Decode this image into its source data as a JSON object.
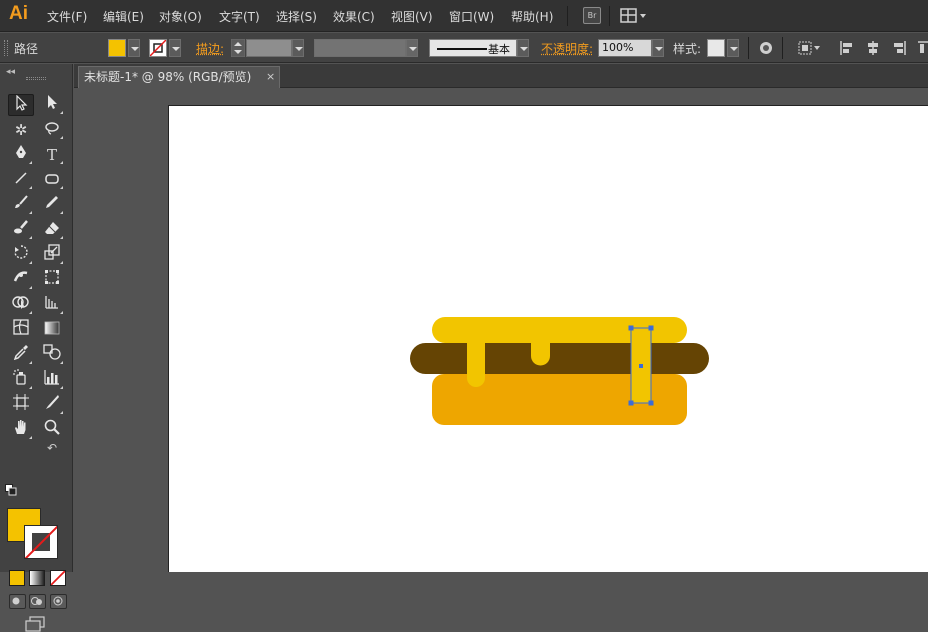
{
  "app": {
    "logo": "Ai",
    "menus": [
      "文件(F)",
      "编辑(E)",
      "对象(O)",
      "文字(T)",
      "选择(S)",
      "效果(C)",
      "视图(V)",
      "窗口(W)",
      "帮助(H)"
    ],
    "bridge_label": "Br"
  },
  "control_bar": {
    "selection_type": "路径",
    "stroke_label": "描边:",
    "stroke_profile": "基本",
    "opacity_label": "不透明度:",
    "opacity_value": "100%",
    "style_label": "样式:"
  },
  "document": {
    "tab_title": "未标题-1* @ 98% (RGB/预览)",
    "tab_close": "×"
  },
  "colors": {
    "fill": "#f4c200",
    "stroke": "none",
    "bun_top": "#f2c500",
    "patty": "#654404",
    "bun_bottom": "#eea600",
    "selection": "#3b6cd8"
  },
  "tools": {
    "icons": [
      "selection-tool-icon",
      "direct-selection-tool-icon",
      "magic-wand-tool-icon",
      "lasso-tool-icon",
      "pen-tool-icon",
      "type-tool-icon",
      "line-segment-tool-icon",
      "rounded-rectangle-tool-icon",
      "paintbrush-tool-icon",
      "pencil-tool-icon",
      "blob-brush-tool-icon",
      "eraser-tool-icon",
      "rotate-tool-icon",
      "scale-tool-icon",
      "width-tool-icon",
      "free-transform-tool-icon",
      "shape-builder-tool-icon",
      "perspective-grid-tool-icon",
      "mesh-tool-icon",
      "gradient-tool-icon",
      "eyedropper-tool-icon",
      "blend-tool-icon",
      "symbol-sprayer-tool-icon",
      "column-graph-tool-icon",
      "artboard-tool-icon",
      "slice-tool-icon",
      "hand-tool-icon",
      "zoom-tool-icon"
    ],
    "active": "selection-tool-icon"
  }
}
